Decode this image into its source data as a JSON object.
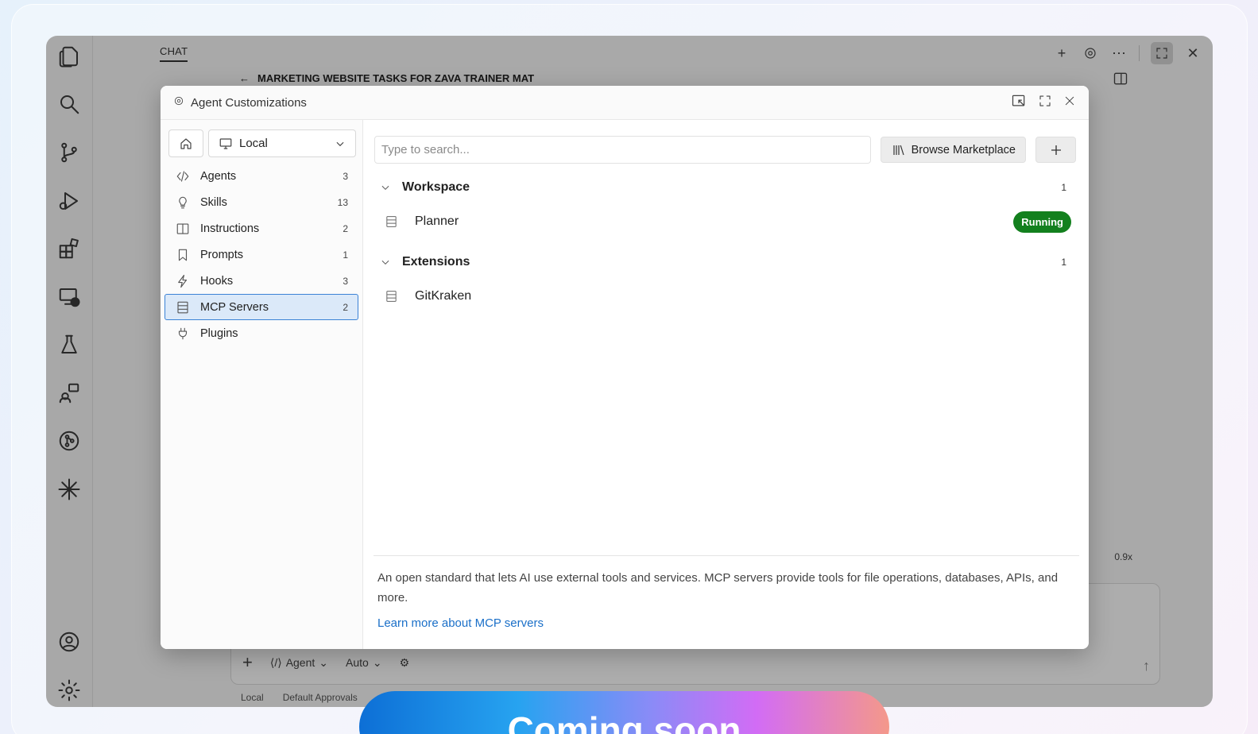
{
  "app": {
    "chat_tab": "CHAT",
    "chat_title": "MARKETING WEBSITE TASKS FOR ZAVA TRAINER MAT",
    "zoom": "0.9x",
    "input_bar": {
      "agent_label": "Agent",
      "model_label": "Auto"
    },
    "below_bar": {
      "local_label": "Local",
      "approvals_label": "Default Approvals"
    }
  },
  "dialog": {
    "title": "Agent Customizations",
    "location": {
      "selected": "Local"
    },
    "nav": [
      {
        "label": "Agents",
        "count": "3",
        "icon": "agents-icon"
      },
      {
        "label": "Skills",
        "count": "13",
        "icon": "lightbulb-icon"
      },
      {
        "label": "Instructions",
        "count": "2",
        "icon": "book-icon"
      },
      {
        "label": "Prompts",
        "count": "1",
        "icon": "bookmark-icon"
      },
      {
        "label": "Hooks",
        "count": "3",
        "icon": "lightning-icon"
      },
      {
        "label": "MCP Servers",
        "count": "2",
        "icon": "server-icon",
        "selected": true
      },
      {
        "label": "Plugins",
        "count": "",
        "icon": "plug-icon"
      }
    ],
    "search": {
      "placeholder": "Type to search..."
    },
    "browse_label": "Browse Marketplace",
    "groups": [
      {
        "name": "Workspace",
        "count": "1",
        "items": [
          {
            "name": "Planner",
            "status": "Running"
          }
        ]
      },
      {
        "name": "Extensions",
        "count": "1",
        "items": [
          {
            "name": "GitKraken"
          }
        ]
      }
    ],
    "footer": {
      "description": "An open standard that lets AI use external tools and services. MCP servers provide tools for file operations, databases, APIs, and more.",
      "link": "Learn more about MCP servers"
    }
  },
  "banner": {
    "text": "Coming soon"
  },
  "colors": {
    "accent": "#3b82d6",
    "running": "#13801e",
    "link": "#1a6fc8"
  }
}
